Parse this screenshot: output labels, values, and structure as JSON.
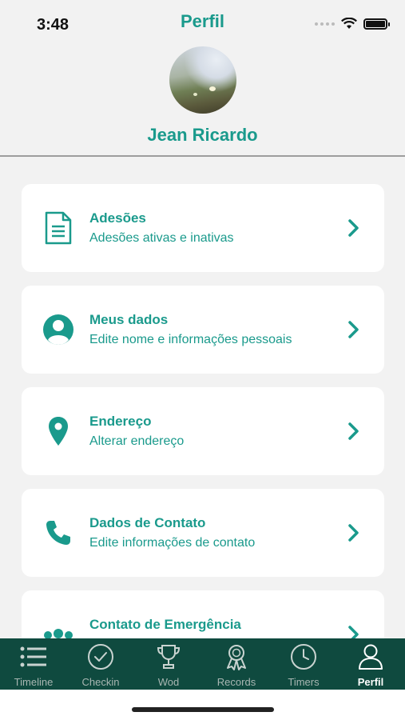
{
  "status_bar": {
    "time": "3:48"
  },
  "nav": {
    "title": "Perfil"
  },
  "profile": {
    "name": "Jean Ricardo"
  },
  "menu": [
    {
      "icon": "document-icon",
      "title": "Adesões",
      "subtitle": "Adesões ativas e inativas"
    },
    {
      "icon": "user-circle-icon",
      "title": "Meus dados",
      "subtitle": "Edite nome e informações pessoais"
    },
    {
      "icon": "location-pin-icon",
      "title": "Endereço",
      "subtitle": "Alterar endereço"
    },
    {
      "icon": "phone-icon",
      "title": "Dados de Contato",
      "subtitle": "Edite informações de contato"
    },
    {
      "icon": "group-icon",
      "title": "Contato de Emergência",
      "subtitle": ""
    }
  ],
  "tabs": [
    {
      "icon": "list-icon",
      "label": "Timeline"
    },
    {
      "icon": "check-circle-icon",
      "label": "Checkin"
    },
    {
      "icon": "trophy-icon",
      "label": "Wod"
    },
    {
      "icon": "award-ribbon-icon",
      "label": "Records"
    },
    {
      "icon": "clock-icon",
      "label": "Timers"
    },
    {
      "icon": "person-icon",
      "label": "Perfil"
    }
  ],
  "colors": {
    "accent": "#1a9a8c",
    "tab_bar": "#0f4a3f",
    "background": "#f2f2f2"
  }
}
